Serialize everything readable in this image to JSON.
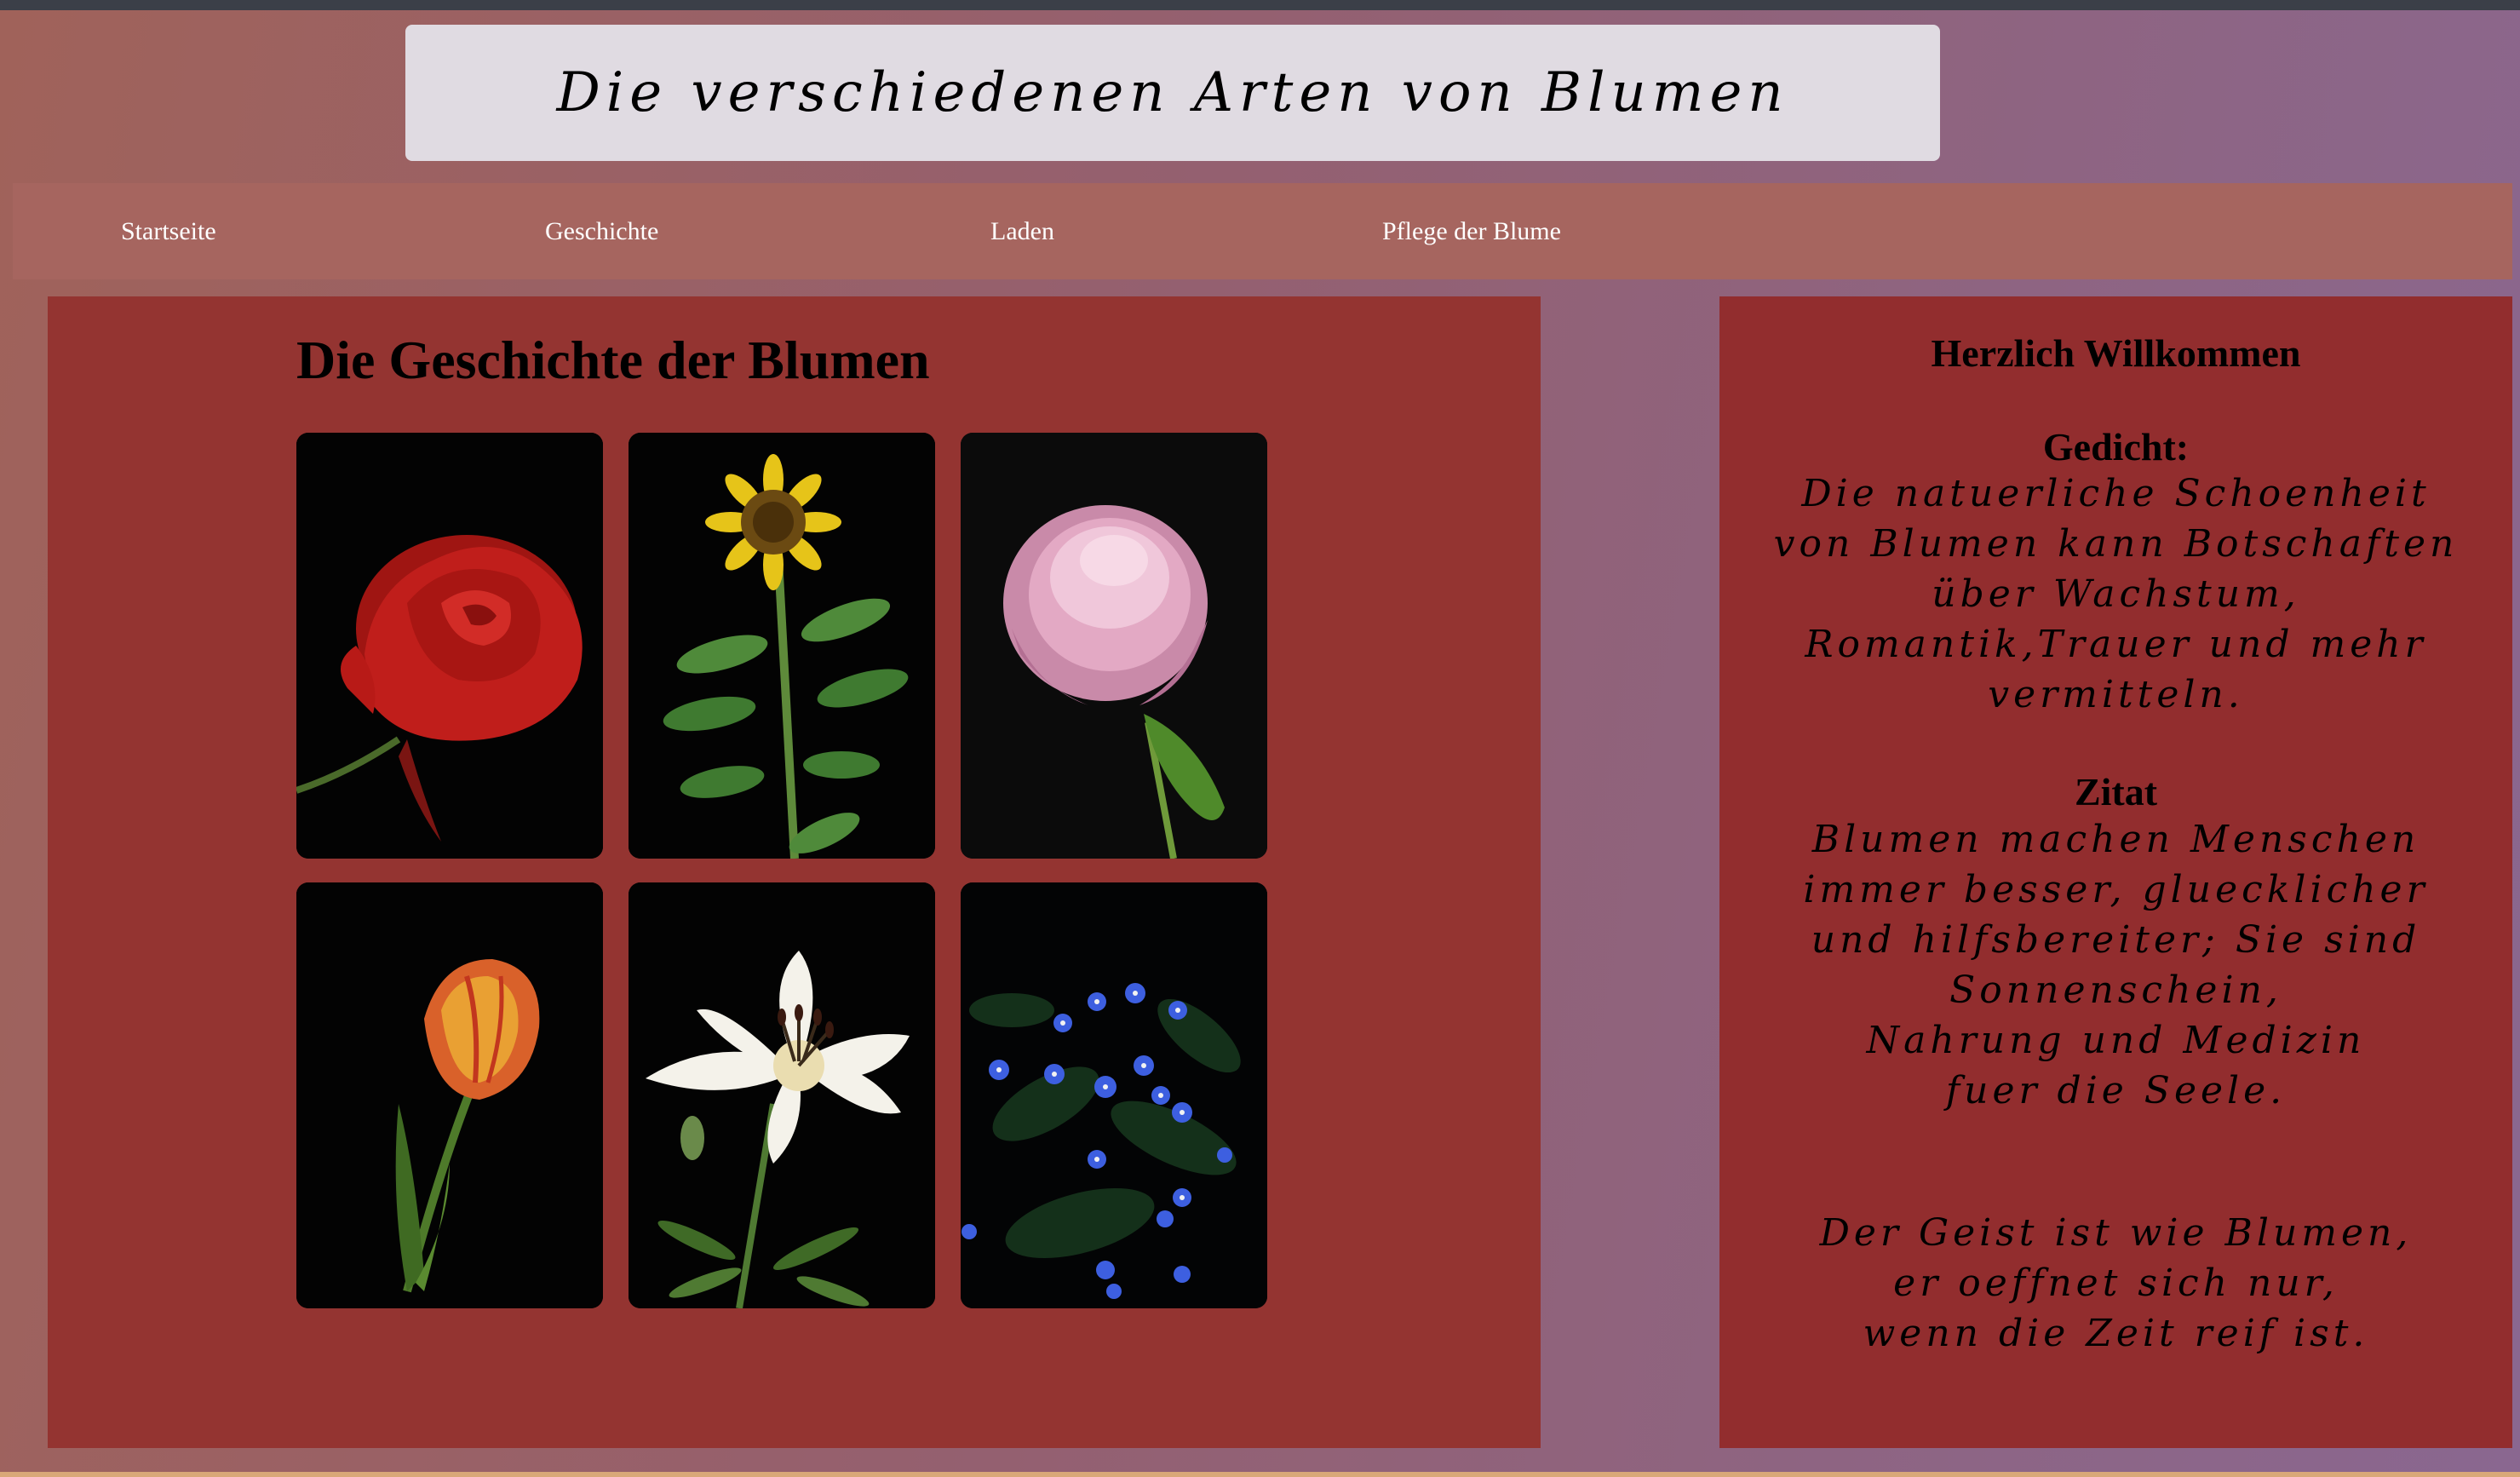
{
  "page": {
    "title": "Die verschiedenen Arten von Blumen"
  },
  "nav": {
    "items": [
      {
        "label": "Startseite"
      },
      {
        "label": "Geschichte"
      },
      {
        "label": "Laden"
      },
      {
        "label": "Pflege der Blume"
      }
    ]
  },
  "main": {
    "heading": "Die Geschichte der Blumen",
    "gallery": [
      {
        "flower": "rose",
        "icon": "rose-image"
      },
      {
        "flower": "sunflower",
        "icon": "sunflower-image"
      },
      {
        "flower": "peony",
        "icon": "peony-image"
      },
      {
        "flower": "tulip",
        "icon": "tulip-image"
      },
      {
        "flower": "lily",
        "icon": "lily-image"
      },
      {
        "flower": "forget-me-not",
        "icon": "forget-me-not-image"
      }
    ]
  },
  "sidebar": {
    "welcome": "Herzlich Willkommen",
    "poem_heading": "Gedicht:",
    "poem_lines": [
      "Die natuerliche Schoenheit",
      "von Blumen kann Botschaften",
      "über Wachstum,",
      "Romantik,Trauer und mehr",
      "vermitteln."
    ],
    "quote_heading": "Zitat",
    "quote_lines": [
      "Blumen machen Menschen",
      "immer besser, gluecklicher",
      "und hilfsbereiter; Sie sind",
      "Sonnenschein,",
      "Nahrung und Medizin",
      "fuer die Seele."
    ],
    "quote2_lines": [
      "Der Geist ist wie Blumen,",
      "er oeffnet sich nur,",
      "wenn die Zeit reif ist."
    ]
  },
  "colors": {
    "title_box": "#e0dbe2",
    "nav_bar": "#a6655f",
    "main_panel": "#943431",
    "side_panel": "#922d2e",
    "nav_text": "#ffffff"
  }
}
